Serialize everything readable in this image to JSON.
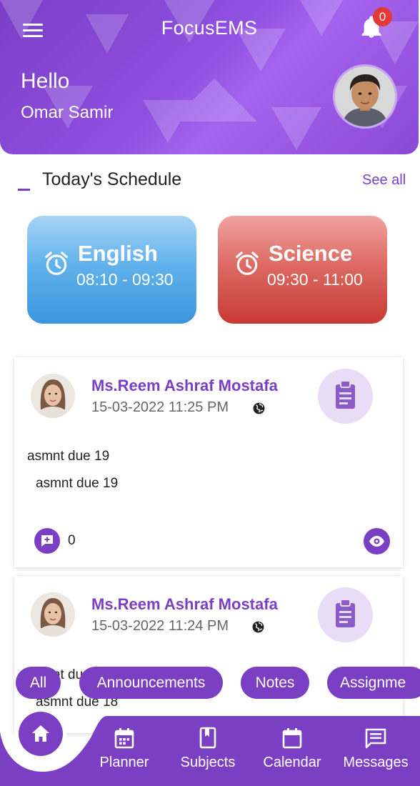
{
  "colors": {
    "primary": "#7b3fc4",
    "header_gradient_start": "#7a3fc6",
    "header_gradient_end": "#a564ee",
    "english_card": "#4aa3e4",
    "science_card": "#d0524b",
    "badge": "#e53935"
  },
  "header": {
    "menu_icon": "hamburger-menu-icon",
    "title": "FocusEMS",
    "notification_icon": "bell-icon",
    "notification_count": "0",
    "greeting": "Hello",
    "user_name": "Omar Samir"
  },
  "schedule": {
    "title": "Today's Schedule",
    "see_all": "See all",
    "classes": [
      {
        "subject": "English",
        "time": "08:10 - 09:30",
        "icon": "alarm-clock-icon"
      },
      {
        "subject": "Science",
        "time": "09:30 - 11:00",
        "icon": "alarm-clock-icon"
      }
    ]
  },
  "posts": [
    {
      "author": "Ms.Reem Ashraf Mostafa",
      "date": "15-03-2022 11:25 PM",
      "visibility_icon": "globe-icon",
      "type_icon": "clipboard-icon",
      "title": "asmnt due 19",
      "body": "asmnt due 19",
      "comment_icon": "add-comment-icon",
      "comment_count": "0",
      "view_icon": "eye-icon"
    },
    {
      "author": "Ms.Reem Ashraf Mostafa",
      "date": "15-03-2022 11:24 PM",
      "visibility_icon": "globe-icon",
      "type_icon": "clipboard-icon",
      "title": "asmnt due 18",
      "body": "asmnt due 18"
    }
  ],
  "filters": [
    "All",
    "Announcements",
    "Notes",
    "Assignme"
  ],
  "bottom_nav": {
    "home_icon": "home-icon",
    "items": [
      {
        "label": "Planner",
        "icon": "planner-icon"
      },
      {
        "label": "Subjects",
        "icon": "book-icon"
      },
      {
        "label": "Calendar",
        "icon": "calendar-icon"
      },
      {
        "label": "Messages",
        "icon": "message-icon"
      }
    ]
  }
}
